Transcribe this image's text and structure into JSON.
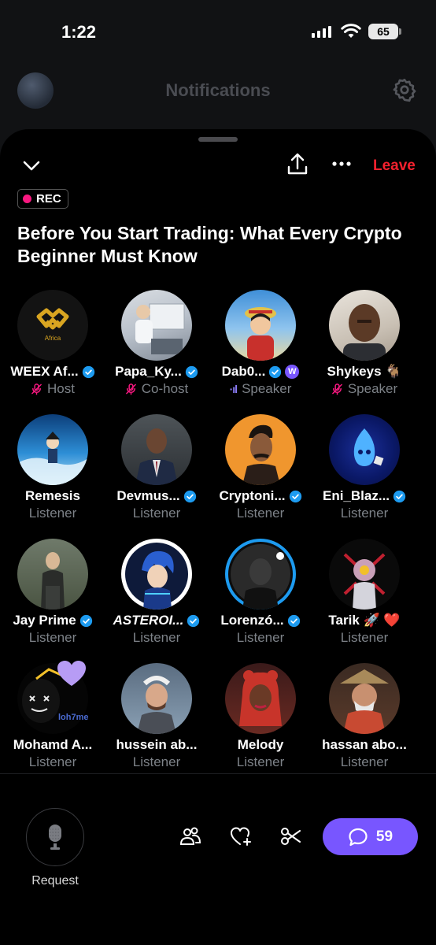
{
  "status_bar": {
    "time": "1:22",
    "battery": "65"
  },
  "background_header": {
    "title": "Notifications"
  },
  "space": {
    "leave_label": "Leave",
    "rec_label": "REC",
    "title": "Before You Start Trading: What Every Crypto Beginner Must Know"
  },
  "participants": [
    {
      "name": "WEEX Af...",
      "role": "Host",
      "verified": true,
      "role_icon": "mic-off"
    },
    {
      "name": "Papa_Ky...",
      "role": "Co-host",
      "verified": true,
      "role_icon": "mic-off"
    },
    {
      "name": "Dab0...",
      "role": "Speaker",
      "verified": true,
      "role_icon": "speaking"
    },
    {
      "name": "Shykeys 🐐",
      "role": "Speaker",
      "verified": false,
      "role_icon": "mic-off"
    },
    {
      "name": "Remesis",
      "role": "Listener",
      "verified": false
    },
    {
      "name": "Devmus...",
      "role": "Listener",
      "verified": true
    },
    {
      "name": "Cryptoni...",
      "role": "Listener",
      "verified": true
    },
    {
      "name": "Eni_Blaz...",
      "role": "Listener",
      "verified": true
    },
    {
      "name": "Jay Prime",
      "role": "Listener",
      "verified": true
    },
    {
      "name": "ASTEROI...",
      "role": "Listener",
      "verified": true
    },
    {
      "name": "Lorenzó...",
      "role": "Listener",
      "verified": true
    },
    {
      "name": "Tarik 🚀 ❤️",
      "role": "Listener",
      "verified": false
    },
    {
      "name": "Mohamd A...",
      "role": "Listener",
      "verified": false
    },
    {
      "name": "hussein ab...",
      "role": "Listener",
      "verified": false
    },
    {
      "name": "Melody",
      "role": "Listener",
      "verified": false
    },
    {
      "name": "hassan abo...",
      "role": "Listener",
      "verified": false
    }
  ],
  "bottom_bar": {
    "request_label": "Request",
    "comments_count": "59"
  },
  "colors": {
    "accent": "#7856ff",
    "leave": "#f4212e",
    "rec": "#f91880",
    "verified": "#1d9bf0"
  }
}
